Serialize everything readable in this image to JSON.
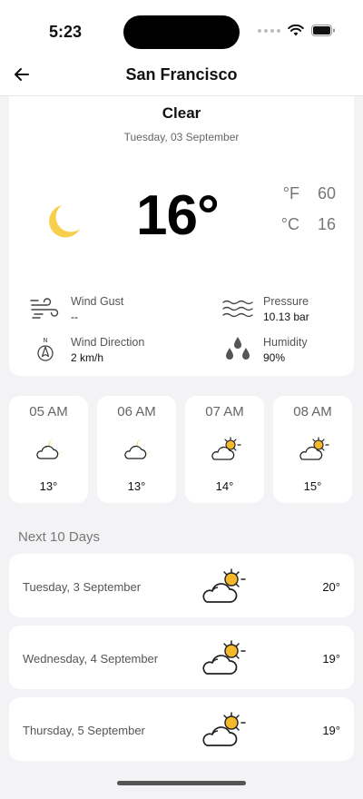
{
  "status_bar": {
    "time": "5:23"
  },
  "nav": {
    "title": "San Francisco"
  },
  "current": {
    "condition": "Clear",
    "date": "Tuesday, 03 September",
    "temperature": "16°",
    "units": [
      {
        "label": "°F",
        "value": "60"
      },
      {
        "label": "°C",
        "value": "16"
      }
    ],
    "details": [
      {
        "label": "Wind Gust",
        "value": "--",
        "icon": "wind-icon"
      },
      {
        "label": "Pressure",
        "value": "10.13 bar",
        "icon": "pressure-icon"
      },
      {
        "label": "Wind Direction",
        "value": "2 km/h",
        "icon": "compass-icon"
      },
      {
        "label": "Humidity",
        "value": "90%",
        "icon": "humidity-icon"
      }
    ]
  },
  "hourly": [
    {
      "hour": "05 AM",
      "temp": "13°",
      "icon": "cloudy-night-icon"
    },
    {
      "hour": "06 AM",
      "temp": "13°",
      "icon": "cloudy-night-icon"
    },
    {
      "hour": "07 AM",
      "temp": "14°",
      "icon": "partly-cloudy-icon"
    },
    {
      "hour": "08 AM",
      "temp": "15°",
      "icon": "partly-cloudy-icon"
    }
  ],
  "forecast_title": "Next 10 Days",
  "forecast": [
    {
      "day": "Tuesday, 3 September",
      "temp": "20°",
      "icon": "partly-cloudy-icon"
    },
    {
      "day": "Wednesday, 4 September",
      "temp": "19°",
      "icon": "partly-cloudy-icon"
    },
    {
      "day": "Thursday, 5 September",
      "temp": "19°",
      "icon": "partly-cloudy-icon"
    }
  ],
  "colors": {
    "sun": "#f5b82a",
    "moon": "#f6d04d",
    "background": "#f3f3f6",
    "card": "#ffffff"
  }
}
